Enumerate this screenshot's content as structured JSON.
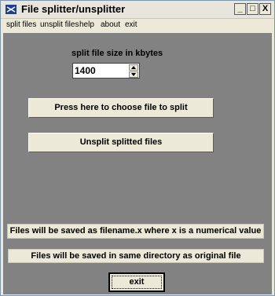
{
  "window": {
    "title": "File splitter/unsplitter",
    "controls": {
      "minimize": "_",
      "maximize": "□",
      "close": "X"
    }
  },
  "menu": [
    "split files",
    "unsplit files",
    "help",
    "about",
    "exit"
  ],
  "split_size": {
    "label": "split file size in kbytes",
    "value": "1400"
  },
  "buttons": {
    "choose_split": "Press here to choose file to split",
    "unsplit": "Unsplit splitted files",
    "exit": "exit"
  },
  "info": {
    "naming": "Files will be saved as filename.x where x is a numerical value",
    "directory": "Files will be saved in same directory as original file"
  },
  "colors": {
    "client_background": "#828282",
    "button_face": "#ece9d8"
  }
}
